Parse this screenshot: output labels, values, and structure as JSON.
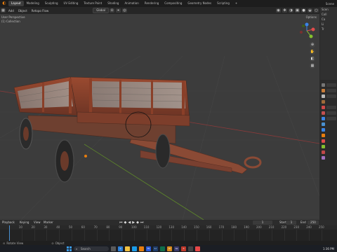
{
  "menubar": {
    "tabs": [
      "Layout",
      "Modeling",
      "Sculpting",
      "UV Editing",
      "Texture Paint",
      "Shading",
      "Animation",
      "Rendering",
      "Compositing",
      "Geometry Nodes",
      "Scripting",
      "+"
    ],
    "active_tab": "Layout",
    "right_label": "Scene"
  },
  "header": {
    "items": [
      "Add",
      "Object",
      "Retopo Flow"
    ],
    "transform_orientation": "Global",
    "options_label": "Options"
  },
  "viewport": {
    "view_label": "User Perspective",
    "collection_label": "(1) Collection"
  },
  "outliner": {
    "rows": [
      "Scen",
      "Coll",
      "Ca",
      "Li",
      "Tr"
    ]
  },
  "timeline": {
    "playback": "Playback",
    "keying": "Keying",
    "view": "View",
    "marker": "Marker",
    "current_frame": "1",
    "start_label": "Start",
    "start_value": "1",
    "end_label": "End",
    "end_value": "250",
    "ticks": [
      "10",
      "20",
      "30",
      "40",
      "50",
      "60",
      "70",
      "80",
      "90",
      "100",
      "110",
      "120",
      "130",
      "140",
      "150",
      "160",
      "170",
      "180",
      "190",
      "200",
      "210",
      "220",
      "230",
      "240",
      "250"
    ]
  },
  "status": {
    "left": "Rotate View",
    "middle": "Object"
  },
  "taskbar": {
    "search_placeholder": "Search",
    "clock": "1:36 PM"
  },
  "colors": {
    "accent": "#e87d0d",
    "gizmo_x": "#e04b4b",
    "gizmo_y": "#84c02e",
    "gizmo_z": "#3a84e6"
  }
}
